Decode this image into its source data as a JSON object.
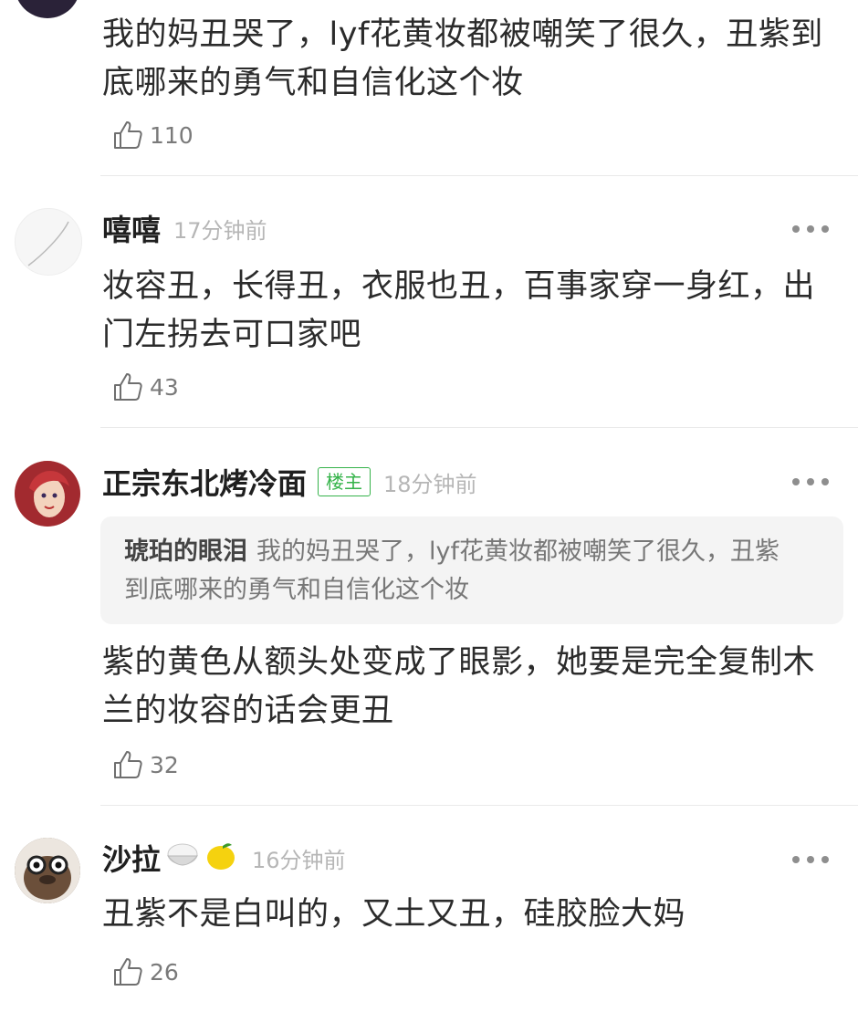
{
  "comments": [
    {
      "text": "我的妈丑哭了，lyf花黄妆都被嘲笑了很久，丑紫到底哪来的勇气和自信化这个妆",
      "likes": "110"
    },
    {
      "username": "嘻嘻",
      "time": "17分钟前",
      "text": "妆容丑，长得丑，衣服也丑，百事家穿一身红，出门左拐去可口家吧",
      "likes": "43"
    },
    {
      "username": "正宗东北烤冷面",
      "badge": "楼主",
      "time": "18分钟前",
      "quote_user": "琥珀的眼泪",
      "quote_text": "我的妈丑哭了，lyf花黄妆都被嘲笑了很久，丑紫到底哪来的勇气和自信化这个妆",
      "text": "紫的黄色从额头处变成了眼影，她要是完全复制木兰的妆容的话会更丑",
      "likes": "32"
    },
    {
      "username": "沙拉",
      "username_emojis": [
        "rice-bowl-emoji",
        "lemon-emoji"
      ],
      "time": "16分钟前",
      "text": "丑紫不是白叫的，又土又丑，硅胶脸大妈",
      "likes": "26"
    }
  ],
  "colors": {
    "badge": "#35b34a",
    "secondary_text": "#b6b6b6",
    "quote_bg": "#f4f4f4"
  },
  "icons": {
    "like": "thumbs-up-outline-icon",
    "more": "more-dots-icon"
  }
}
